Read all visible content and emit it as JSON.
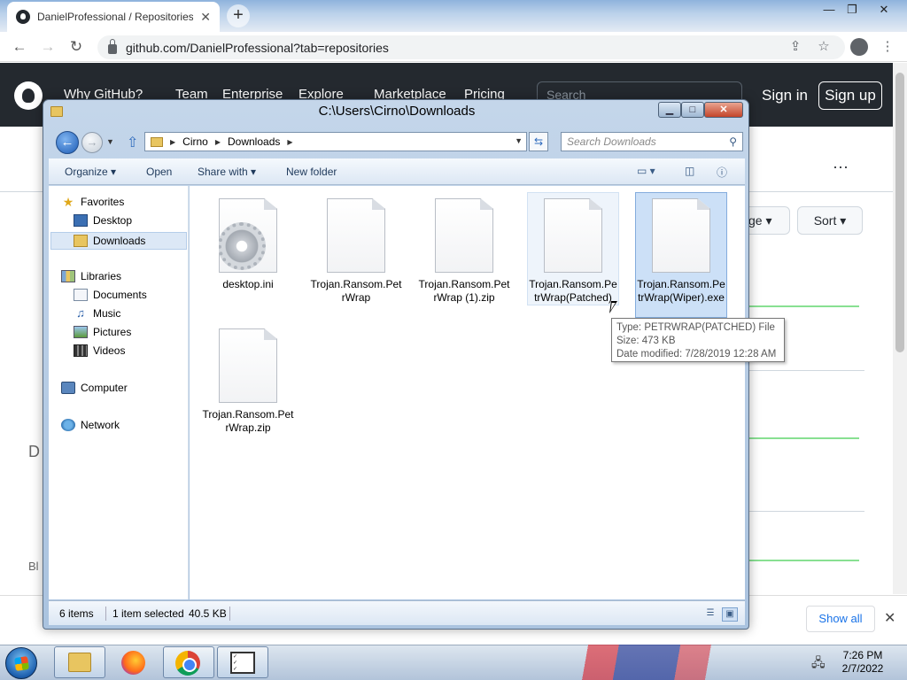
{
  "browser": {
    "tab_title": "DanielProfessional / Repositories",
    "tab_close": "✕",
    "new_tab": "+",
    "url": "github.com/DanielProfessional?tab=repositories",
    "window_controls": {
      "minimize": "—",
      "restore": "❐",
      "close": "✕"
    }
  },
  "github": {
    "nav": [
      "Why GitHub?",
      "Team",
      "Enterprise",
      "Explore",
      "Marketplace",
      "Pricing"
    ],
    "search_placeholder": "Search",
    "sign_in": "Sign in",
    "sign_up": "Sign up",
    "sort_label": "Sort",
    "language_label": "ge",
    "more": "···",
    "fragments": {
      "d": "D",
      "bl": "Bl"
    }
  },
  "downloads_bar": {
    "show_all": "Show all",
    "close": "✕"
  },
  "explorer": {
    "title": "C:\\Users\\Cirno\\Downloads",
    "breadcrumb": [
      "Cirno",
      "Downloads"
    ],
    "search_placeholder": "Search Downloads",
    "commands": {
      "organize": "Organize",
      "open": "Open",
      "share_with": "Share with",
      "new_folder": "New folder"
    },
    "nav_tree": {
      "favorites": "Favorites",
      "desktop": "Desktop",
      "downloads": "Downloads",
      "libraries": "Libraries",
      "documents": "Documents",
      "music": "Music",
      "pictures": "Pictures",
      "videos": "Videos",
      "computer": "Computer",
      "network": "Network"
    },
    "files": [
      {
        "name": "desktop.ini"
      },
      {
        "name": "Trojan.Ransom.PetrWrap"
      },
      {
        "name": "Trojan.Ransom.PetrWrap (1).zip"
      },
      {
        "name": "Trojan.Ransom.PetrWrap(Patched)"
      },
      {
        "name": "Trojan.Ransom.PetrWrap(Wiper).exe"
      },
      {
        "name": "Trojan.Ransom.PetrWrap.zip"
      }
    ],
    "tooltip": {
      "type": "Type: PETRWRAP(PATCHED) File",
      "size": "Size: 473 KB",
      "modified": "Date modified: 7/28/2019 12:28 AM"
    },
    "status": {
      "item_count": "6 items",
      "selection": "1 item selected",
      "selection_size": "40.5 KB"
    }
  },
  "taskbar": {
    "time": "7:26 PM",
    "date": "2/7/2022"
  }
}
